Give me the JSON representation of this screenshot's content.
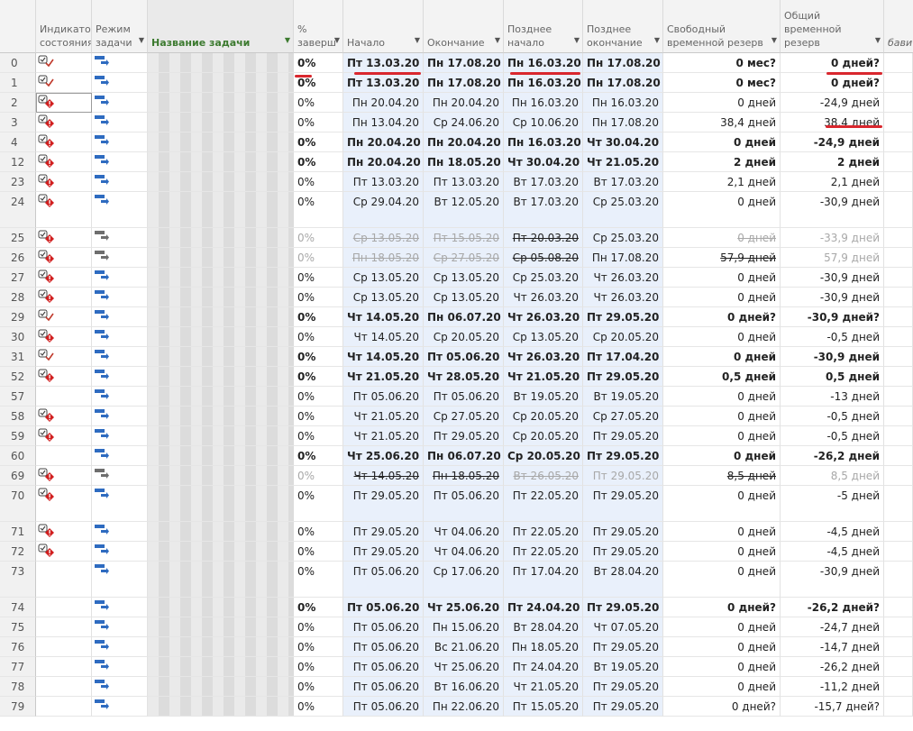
{
  "columns": {
    "indicator": "Индикатор\nсостояния",
    "mode": "Режим\nзадачи",
    "name": "Название задачи",
    "pct": "%\nзаверш",
    "start": "Начало",
    "finish": "Окончание",
    "late_start": "Позднее\nначало",
    "late_finish": "Позднее\nокончание",
    "free_slack": "Свободный\nвременной резерв",
    "total_slack": "Общий\nвременной\nрезерв",
    "more": "бавит"
  },
  "rows": [
    {
      "id": "0",
      "ind": "check",
      "mode": "auto",
      "pct": "0%",
      "start": "Пт 13.03.20",
      "finish": "Пн 17.08.20",
      "ls": "Пн 16.03.20",
      "lf": "Пн 17.08.20",
      "free": "0 мес?",
      "total": "0 дней?",
      "bold": true
    },
    {
      "id": "1",
      "ind": "check",
      "mode": "auto",
      "pct": "0%",
      "start": "Пт 13.03.20",
      "finish": "Пн 17.08.20",
      "ls": "Пн 16.03.20",
      "lf": "Пн 17.08.20",
      "free": "0 мес?",
      "total": "0 дней?",
      "bold": true
    },
    {
      "id": "2",
      "ind": "check-alert",
      "mode": "auto",
      "pct": "0%",
      "start": "Пн 20.04.20",
      "finish": "Пн 20.04.20",
      "ls": "Пн 16.03.20",
      "lf": "Пн 16.03.20",
      "free": "0 дней",
      "total": "-24,9 дней",
      "selected": true
    },
    {
      "id": "3",
      "ind": "check-alert",
      "mode": "auto",
      "pct": "0%",
      "start": "Пн 13.04.20",
      "finish": "Ср 24.06.20",
      "ls": "Ср 10.06.20",
      "lf": "Пн 17.08.20",
      "free": "38,4 дней",
      "total": "38,4 дней"
    },
    {
      "id": "4",
      "ind": "check-alert",
      "mode": "auto",
      "pct": "0%",
      "start": "Пн 20.04.20",
      "finish": "Пн 20.04.20",
      "ls": "Пн 16.03.20",
      "lf": "Чт 30.04.20",
      "free": "0 дней",
      "total": "-24,9 дней",
      "bold": true
    },
    {
      "id": "12",
      "ind": "check-alert",
      "mode": "auto",
      "pct": "0%",
      "start": "Пн 20.04.20",
      "finish": "Пн 18.05.20",
      "ls": "Чт 30.04.20",
      "lf": "Чт 21.05.20",
      "free": "2 дней",
      "total": "2 дней",
      "bold": true
    },
    {
      "id": "23",
      "ind": "check-alert",
      "mode": "auto",
      "pct": "0%",
      "start": "Пт 13.03.20",
      "finish": "Пт 13.03.20",
      "ls": "Вт 17.03.20",
      "lf": "Вт 17.03.20",
      "free": "2,1 дней",
      "total": "2,1 дней"
    },
    {
      "id": "24",
      "ind": "check-alert",
      "mode": "auto",
      "pct": "0%",
      "start": "Ср 29.04.20",
      "finish": "Вт 12.05.20",
      "ls": "Вт 17.03.20",
      "lf": "Ср 25.03.20",
      "free": "0 дней",
      "total": "-30,9 дней",
      "tall": true
    },
    {
      "id": "25",
      "ind": "check-alert",
      "mode": "gray",
      "pct": "0%",
      "start": "Ср 13.05.20",
      "finish": "Пт 15.05.20",
      "ls": "Пт 20.03.20",
      "lf": "Ср 25.03.20",
      "free": "0 дней",
      "total": "-33,9 дней",
      "dim": true,
      "strike": "all",
      "darkls": true
    },
    {
      "id": "26",
      "ind": "check-alert",
      "mode": "gray",
      "pct": "0%",
      "start": "Пн 18.05.20",
      "finish": "Ср 27.05.20",
      "ls": "Ср 05.08.20",
      "lf": "Пн 17.08.20",
      "free": "57,9 дней",
      "total": "57,9 дней",
      "dim": true,
      "strike": "all",
      "darkls": true,
      "darkfree": true
    },
    {
      "id": "27",
      "ind": "check-alert",
      "mode": "auto",
      "pct": "0%",
      "start": "Ср 13.05.20",
      "finish": "Ср 13.05.20",
      "ls": "Ср 25.03.20",
      "lf": "Чт 26.03.20",
      "free": "0 дней",
      "total": "-30,9 дней"
    },
    {
      "id": "28",
      "ind": "check-alert",
      "mode": "auto",
      "pct": "0%",
      "start": "Ср 13.05.20",
      "finish": "Ср 13.05.20",
      "ls": "Чт 26.03.20",
      "lf": "Чт 26.03.20",
      "free": "0 дней",
      "total": "-30,9 дней"
    },
    {
      "id": "29",
      "ind": "check",
      "mode": "auto",
      "pct": "0%",
      "start": "Чт 14.05.20",
      "finish": "Пн 06.07.20",
      "ls": "Чт 26.03.20",
      "lf": "Пт 29.05.20",
      "free": "0 дней?",
      "total": "-30,9 дней?",
      "bold": true
    },
    {
      "id": "30",
      "ind": "check-alert",
      "mode": "auto",
      "pct": "0%",
      "start": "Чт 14.05.20",
      "finish": "Ср 20.05.20",
      "ls": "Ср 13.05.20",
      "lf": "Ср 20.05.20",
      "free": "0 дней",
      "total": "-0,5 дней"
    },
    {
      "id": "31",
      "ind": "check",
      "mode": "auto",
      "pct": "0%",
      "start": "Чт 14.05.20",
      "finish": "Пт 05.06.20",
      "ls": "Чт 26.03.20",
      "lf": "Пт 17.04.20",
      "free": "0 дней",
      "total": "-30,9 дней",
      "bold": true
    },
    {
      "id": "52",
      "ind": "check-alert",
      "mode": "auto",
      "pct": "0%",
      "start": "Чт 21.05.20",
      "finish": "Чт 28.05.20",
      "ls": "Чт 21.05.20",
      "lf": "Пт 29.05.20",
      "free": "0,5 дней",
      "total": "0,5 дней",
      "bold": true
    },
    {
      "id": "57",
      "ind": "",
      "mode": "auto",
      "pct": "0%",
      "start": "Пт 05.06.20",
      "finish": "Пт 05.06.20",
      "ls": "Вт 19.05.20",
      "lf": "Вт 19.05.20",
      "free": "0 дней",
      "total": "-13 дней"
    },
    {
      "id": "58",
      "ind": "check-alert",
      "mode": "auto",
      "pct": "0%",
      "start": "Чт 21.05.20",
      "finish": "Ср 27.05.20",
      "ls": "Ср 20.05.20",
      "lf": "Ср 27.05.20",
      "free": "0 дней",
      "total": "-0,5 дней"
    },
    {
      "id": "59",
      "ind": "check-alert",
      "mode": "auto",
      "pct": "0%",
      "start": "Чт 21.05.20",
      "finish": "Пт 29.05.20",
      "ls": "Ср 20.05.20",
      "lf": "Пт 29.05.20",
      "free": "0 дней",
      "total": "-0,5 дней"
    },
    {
      "id": "60",
      "ind": "",
      "mode": "auto",
      "pct": "0%",
      "start": "Чт 25.06.20",
      "finish": "Пн 06.07.20",
      "ls": "Ср 20.05.20",
      "lf": "Пт 29.05.20",
      "free": "0 дней",
      "total": "-26,2 дней",
      "bold": true
    },
    {
      "id": "69",
      "ind": "check-alert",
      "mode": "gray",
      "pct": "0%",
      "start": "Чт 14.05.20",
      "finish": "Пн 18.05.20",
      "ls": "Вт 26.05.20",
      "lf": "Пт 29.05.20",
      "free": "8,5 дней",
      "total": "8,5 дней",
      "dim": true,
      "strike": "all",
      "darkstart": true,
      "darkfree": true
    },
    {
      "id": "70",
      "ind": "check-alert",
      "mode": "auto",
      "pct": "0%",
      "start": "Пт 29.05.20",
      "finish": "Пт 05.06.20",
      "ls": "Пт 22.05.20",
      "lf": "Пт 29.05.20",
      "free": "0 дней",
      "total": "-5 дней",
      "tall": true
    },
    {
      "id": "71",
      "ind": "check-alert",
      "mode": "auto",
      "pct": "0%",
      "start": "Пт 29.05.20",
      "finish": "Чт 04.06.20",
      "ls": "Пт 22.05.20",
      "lf": "Пт 29.05.20",
      "free": "0 дней",
      "total": "-4,5 дней"
    },
    {
      "id": "72",
      "ind": "check-alert",
      "mode": "auto",
      "pct": "0%",
      "start": "Пт 29.05.20",
      "finish": "Чт 04.06.20",
      "ls": "Пт 22.05.20",
      "lf": "Пт 29.05.20",
      "free": "0 дней",
      "total": "-4,5 дней"
    },
    {
      "id": "73",
      "ind": "",
      "mode": "auto",
      "pct": "0%",
      "start": "Пт 05.06.20",
      "finish": "Ср 17.06.20",
      "ls": "Пт 17.04.20",
      "lf": "Вт 28.04.20",
      "free": "0 дней",
      "total": "-30,9 дней",
      "tall": true
    },
    {
      "id": "74",
      "ind": "",
      "mode": "auto",
      "pct": "0%",
      "start": "Пт 05.06.20",
      "finish": "Чт 25.06.20",
      "ls": "Пт 24.04.20",
      "lf": "Пт 29.05.20",
      "free": "0 дней?",
      "total": "-26,2 дней?",
      "bold": true
    },
    {
      "id": "75",
      "ind": "",
      "mode": "auto",
      "pct": "0%",
      "start": "Пт 05.06.20",
      "finish": "Пн 15.06.20",
      "ls": "Вт 28.04.20",
      "lf": "Чт 07.05.20",
      "free": "0 дней",
      "total": "-24,7 дней"
    },
    {
      "id": "76",
      "ind": "",
      "mode": "auto",
      "pct": "0%",
      "start": "Пт 05.06.20",
      "finish": "Вс 21.06.20",
      "ls": "Пн 18.05.20",
      "lf": "Пт 29.05.20",
      "free": "0 дней",
      "total": "-14,7 дней"
    },
    {
      "id": "77",
      "ind": "",
      "mode": "auto",
      "pct": "0%",
      "start": "Пт 05.06.20",
      "finish": "Чт 25.06.20",
      "ls": "Пт 24.04.20",
      "lf": "Вт 19.05.20",
      "free": "0 дней",
      "total": "-26,2 дней"
    },
    {
      "id": "78",
      "ind": "",
      "mode": "auto",
      "pct": "0%",
      "start": "Пт 05.06.20",
      "finish": "Вт 16.06.20",
      "ls": "Чт 21.05.20",
      "lf": "Пт 29.05.20",
      "free": "0 дней",
      "total": "-11,2 дней"
    },
    {
      "id": "79",
      "ind": "",
      "mode": "auto",
      "pct": "0%",
      "start": "Пт 05.06.20",
      "finish": "Пн 22.06.20",
      "ls": "Пт 15.05.20",
      "lf": "Пт 29.05.20",
      "free": "0 дней?",
      "total": "-15,7 дней?"
    }
  ],
  "colors": {
    "accent_red": "#d9272e",
    "name_header": "#3c7a2f",
    "shade": "#e9f0fb"
  }
}
